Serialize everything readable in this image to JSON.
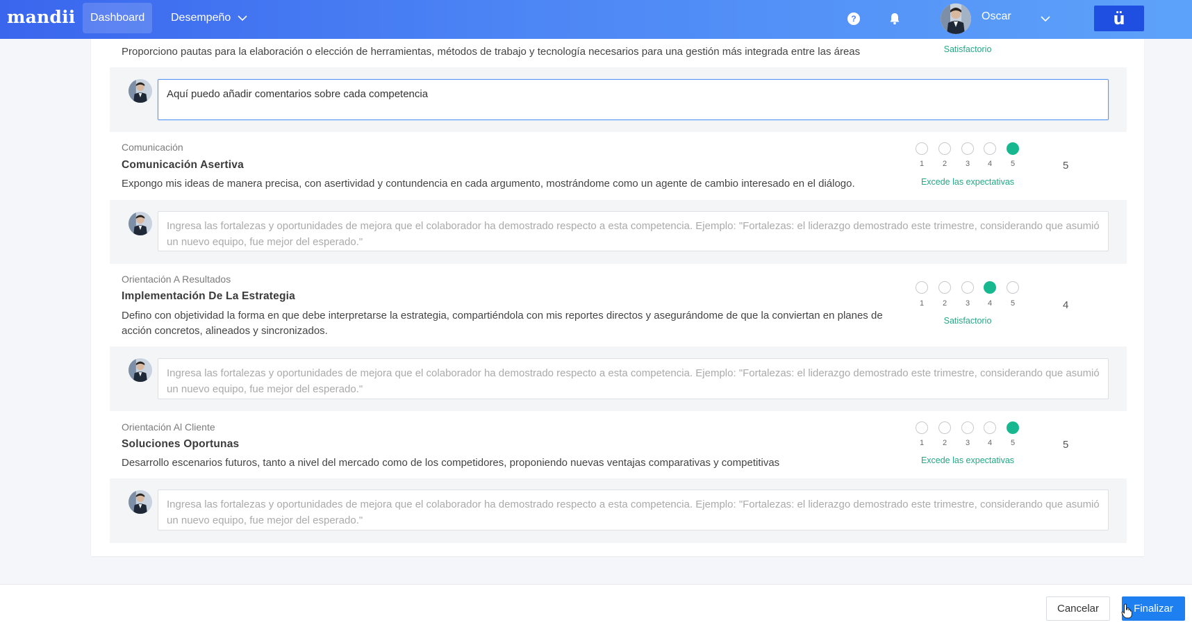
{
  "header": {
    "logo": "mandii",
    "nav": [
      {
        "label": "Dashboard"
      },
      {
        "label": "Desempeño"
      }
    ],
    "user_name": "Oscar",
    "brand_button": "ü"
  },
  "top_partial": {
    "description": "Proporciono pautas para la elaboración o elección de herramientas, métodos de trabajo y tecnología necesarios para una gestión más integrada entre las áreas",
    "rating_label": "Satisfactorio",
    "comment_value": "Aquí puedo añadir comentarios sobre cada competencia"
  },
  "scale": [
    "1",
    "2",
    "3",
    "4",
    "5"
  ],
  "comment_placeholder": "Ingresa las fortalezas y oportunidades de mejora que el colaborador ha demostrado respecto a esta competencia. Ejemplo: \"Fortalezas: el liderazgo demostrado este trimestre, considerando que asumió un nuevo equipo, fue mejor del esperado.\"",
  "competencies": [
    {
      "category": "Comunicación",
      "title": "Comunicación Asertiva",
      "description": "Expongo mis ideas de manera precisa, con asertividad y contundencia en cada argumento, mostrándome como un agente de cambio interesado en el diálogo.",
      "rating": 5,
      "rating_label": "Excede las expectativas",
      "score": "5"
    },
    {
      "category": "Orientación A Resultados",
      "title": "Implementación De La Estrategia",
      "description": "Defino con objetividad la forma en que debe interpretarse la estrategia, compartiéndola con mis reportes directos y asegurándome de que la conviertan en planes de acción concretos, alineados y sincronizados.",
      "rating": 4,
      "rating_label": "Satisfactorio",
      "score": "4"
    },
    {
      "category": "Orientación Al Cliente",
      "title": "Soluciones Oportunas",
      "description": "Desarrollo escenarios futuros, tanto a nivel del mercado como de los competidores, proponiendo nuevas ventajas comparativas y competitivas",
      "rating": 5,
      "rating_label": "Excede las expectativas",
      "score": "5"
    }
  ],
  "footer": {
    "cancel": "Cancelar",
    "finish": "Finalizar"
  },
  "colors": {
    "topbar_start": "#3a66ee",
    "topbar_end": "#5da2fa",
    "selected": "#17b890",
    "rating_text": "#22a884",
    "primary_button": "#1e7ff0"
  }
}
